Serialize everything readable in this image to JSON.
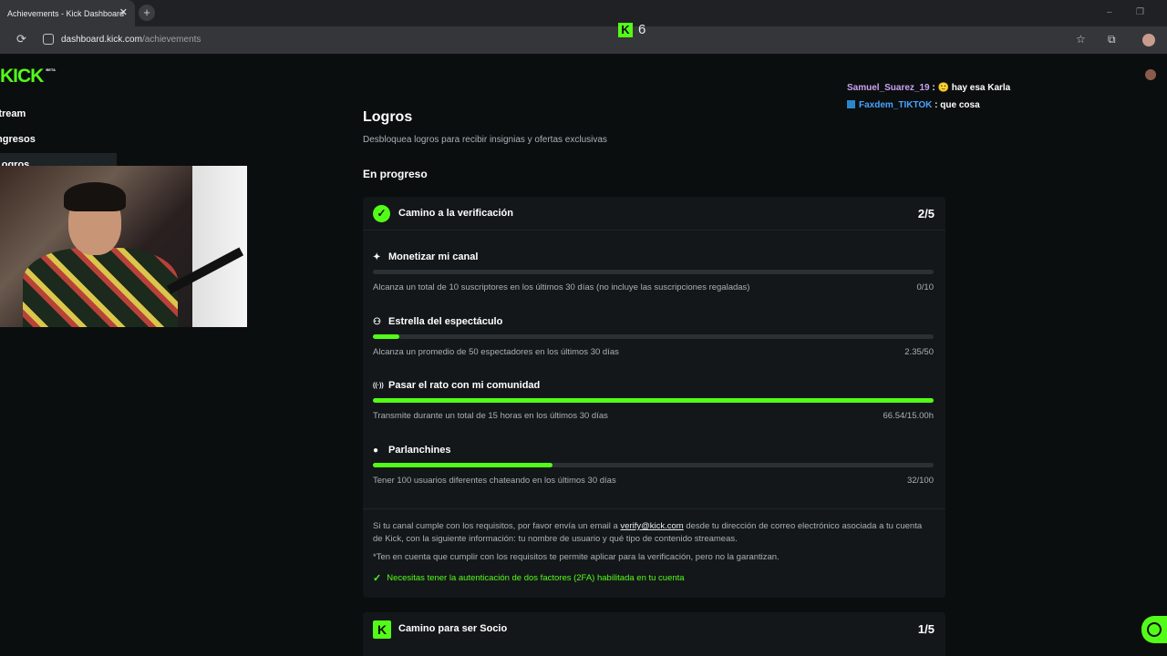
{
  "browser": {
    "tab_title": "Achievements - Kick Dashboard",
    "tab_close": "✕",
    "new_tab": "+",
    "url_host": "dashboard.kick.com",
    "url_path": "/achievements",
    "reload_icon": "⟳",
    "star_icon": "☆",
    "ext_icon": "⧉",
    "minimize": "–",
    "restore": "❐"
  },
  "overlay": {
    "brand_letter": "K",
    "viewer_count": "6"
  },
  "sidebar": {
    "logo": "KICK",
    "logo_badge": "BETA",
    "items": [
      {
        "label": "Stream"
      },
      {
        "label": "Ingresos"
      },
      {
        "label": "Logros"
      }
    ]
  },
  "chat": {
    "messages": [
      {
        "user": "Samuel_Suarez_19",
        "emoji": "🙂",
        "text": "hay esa Karla",
        "color": "#c8a2f0"
      },
      {
        "user": "Faxdem_TIKTOK",
        "text": "que cosa",
        "color": "#47a3ff"
      }
    ],
    "separator": " : "
  },
  "main": {
    "title": "Logros",
    "subtitle": "Desbloquea logros para recibir insignias y ofertas exclusivas",
    "section_title": "En progreso",
    "card1": {
      "title": "Camino a la verificación",
      "count": "2/5",
      "tasks": [
        {
          "icon": "✦",
          "name": "Monetizar mi canal",
          "desc": "Alcanza un total de 10 suscriptores en los últimos 30 días (no incluye las suscripciones regaladas)",
          "value": "0/10",
          "progress": 0
        },
        {
          "icon": "⚇",
          "name": "Estrella del espectáculo",
          "desc": "Alcanza un promedio de 50 espectadores en los últimos 30 días",
          "value": "2.35/50",
          "progress": 0.047
        },
        {
          "icon": "((·))",
          "name": "Pasar el rato con mi comunidad",
          "desc": "Transmite durante un total de 15 horas en los últimos 30 días",
          "value": "66.54/15.00h",
          "progress": 1
        },
        {
          "icon": "●",
          "name": "Parlanchines",
          "desc": "Tener 100 usuarios diferentes chateando en los últimos 30 días",
          "value": "32/100",
          "progress": 0.32
        }
      ],
      "note_part1": "Si tu canal cumple con los requisitos, por favor envía un email a ",
      "note_email": "verify@kick.com",
      "note_part2": " desde tu dirección de correo electrónico asociada a tu cuenta de Kick, con la siguiente información: tu nombre de usuario y qué tipo de contenido streameas.",
      "disclaimer": "*Ten en cuenta que cumplir con los requisitos te permite aplicar para la verificación, pero no la garantizan.",
      "requirement": "Necesitas tener la autenticación de dos factores (2FA) habilitada en tu cuenta"
    },
    "card2": {
      "title": "Camino para ser Socio",
      "count": "1/5"
    }
  },
  "colors": {
    "accent": "#53fc18",
    "background": "#0b0e0f",
    "card": "#131719"
  }
}
